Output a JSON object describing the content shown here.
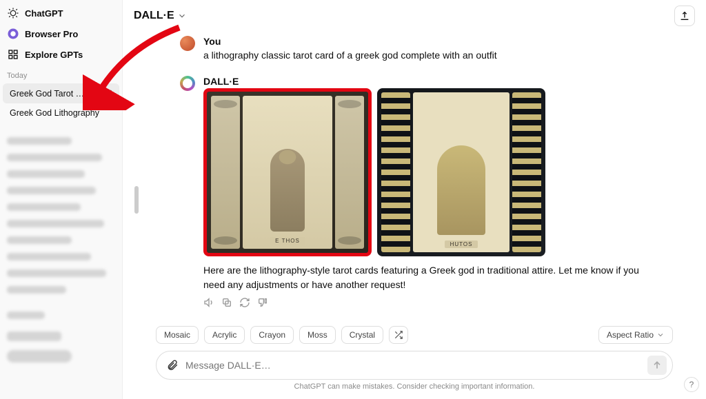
{
  "sidebar": {
    "chatgpt": "ChatGPT",
    "browser_pro": "Browser Pro",
    "explore": "Explore GPTs",
    "today_label": "Today",
    "chats": [
      {
        "label": "Greek God Tarot Cards",
        "active": true
      },
      {
        "label": "Greek God Lithography",
        "active": false
      }
    ]
  },
  "header": {
    "title": "DALL·E"
  },
  "conversation": {
    "user_name": "You",
    "user_prompt": "a lithography classic tarot card of a greek god complete with an outfit",
    "assistant_name": "DALL·E",
    "card1_label": "E THOS",
    "card2_label": "HUTOS",
    "response_text": "Here are the lithography-style tarot cards featuring a Greek god in traditional attire. Let me know if you need any adjustments or have another request!"
  },
  "composer": {
    "chips": [
      "Mosaic",
      "Acrylic",
      "Crayon",
      "Moss",
      "Crystal"
    ],
    "aspect_label": "Aspect Ratio",
    "placeholder": "Message DALL·E…"
  },
  "footer": {
    "disclaimer": "ChatGPT can make mistakes. Consider checking important information."
  },
  "help": "?"
}
